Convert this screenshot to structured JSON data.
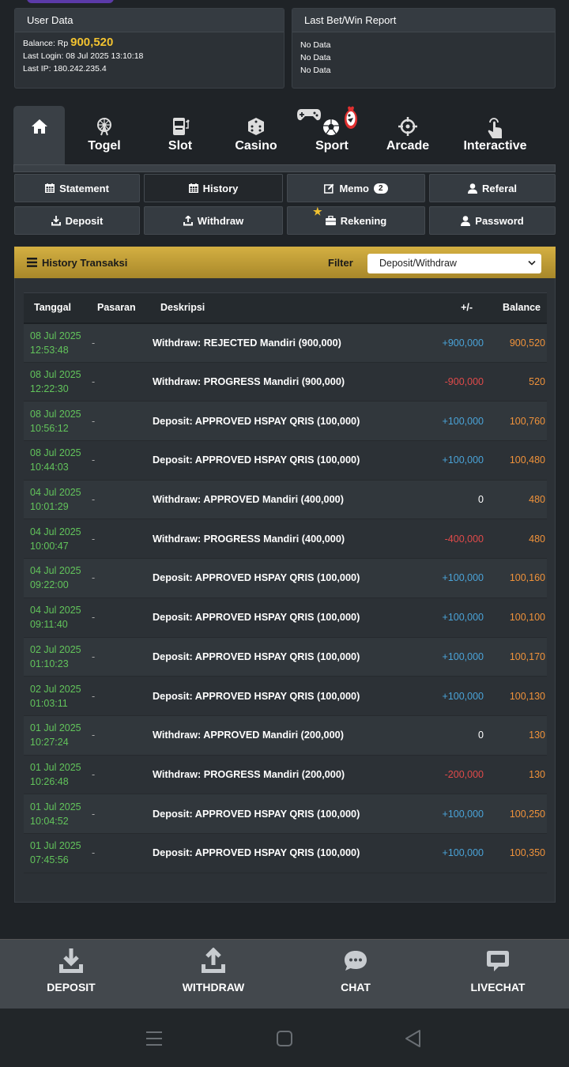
{
  "user_panel": {
    "title": "User Data",
    "balance_label": "Balance: Rp",
    "balance_value": "900,520",
    "last_login": "Last Login: 08 Jul 2025 13:10:18",
    "last_ip": "Last IP: 180.242.235.4"
  },
  "report_panel": {
    "title": "Last Bet/Win Report",
    "lines": [
      "No Data",
      "No Data",
      "No Data"
    ]
  },
  "categories": [
    "Togel",
    "Slot",
    "Casino",
    "Sport",
    "Arcade",
    "Interactive"
  ],
  "menu": {
    "statement": "Statement",
    "history": "History",
    "memo": "Memo",
    "memo_count": "2",
    "referal": "Referal",
    "deposit": "Deposit",
    "withdraw": "Withdraw",
    "rekening": "Rekening",
    "password": "Password"
  },
  "history": {
    "title": "History Transaksi",
    "filter_label": "Filter",
    "filter_value": "Deposit/Withdraw",
    "columns": [
      "Tanggal",
      "Pasaran",
      "Deskripsi",
      "+/-",
      "Balance"
    ],
    "rows": [
      {
        "date": "08 Jul 2025",
        "time": "12:53:48",
        "pasaran": "-",
        "desc": "Withdraw: REJECTED Mandiri (900,000)",
        "amount": "+900,000",
        "sign": "pos",
        "balance": "900,520"
      },
      {
        "date": "08 Jul 2025",
        "time": "12:22:30",
        "pasaran": "-",
        "desc": "Withdraw: PROGRESS Mandiri (900,000)",
        "amount": "-900,000",
        "sign": "neg",
        "balance": "520"
      },
      {
        "date": "08 Jul 2025",
        "time": "10:56:12",
        "pasaran": "-",
        "desc": "Deposit: APPROVED HSPAY QRIS (100,000)",
        "amount": "+100,000",
        "sign": "pos",
        "balance": "100,760"
      },
      {
        "date": "08 Jul 2025",
        "time": "10:44:03",
        "pasaran": "-",
        "desc": "Deposit: APPROVED HSPAY QRIS (100,000)",
        "amount": "+100,000",
        "sign": "pos",
        "balance": "100,480"
      },
      {
        "date": "04 Jul 2025",
        "time": "10:01:29",
        "pasaran": "-",
        "desc": "Withdraw: APPROVED Mandiri (400,000)",
        "amount": "0",
        "sign": "zero",
        "balance": "480"
      },
      {
        "date": "04 Jul 2025",
        "time": "10:00:47",
        "pasaran": "-",
        "desc": "Withdraw: PROGRESS Mandiri (400,000)",
        "amount": "-400,000",
        "sign": "neg",
        "balance": "480"
      },
      {
        "date": "04 Jul 2025",
        "time": "09:22:00",
        "pasaran": "-",
        "desc": "Deposit: APPROVED HSPAY QRIS (100,000)",
        "amount": "+100,000",
        "sign": "pos",
        "balance": "100,160"
      },
      {
        "date": "04 Jul 2025",
        "time": "09:11:40",
        "pasaran": "-",
        "desc": "Deposit: APPROVED HSPAY QRIS (100,000)",
        "amount": "+100,000",
        "sign": "pos",
        "balance": "100,100"
      },
      {
        "date": "02 Jul 2025",
        "time": "01:10:23",
        "pasaran": "-",
        "desc": "Deposit: APPROVED HSPAY QRIS (100,000)",
        "amount": "+100,000",
        "sign": "pos",
        "balance": "100,170"
      },
      {
        "date": "02 Jul 2025",
        "time": "01:03:11",
        "pasaran": "-",
        "desc": "Deposit: APPROVED HSPAY QRIS (100,000)",
        "amount": "+100,000",
        "sign": "pos",
        "balance": "100,130"
      },
      {
        "date": "01 Jul 2025",
        "time": "10:27:24",
        "pasaran": "-",
        "desc": "Withdraw: APPROVED Mandiri (200,000)",
        "amount": "0",
        "sign": "zero",
        "balance": "130"
      },
      {
        "date": "01 Jul 2025",
        "time": "10:26:48",
        "pasaran": "-",
        "desc": "Withdraw: PROGRESS Mandiri (200,000)",
        "amount": "-200,000",
        "sign": "neg",
        "balance": "130"
      },
      {
        "date": "01 Jul 2025",
        "time": "10:04:52",
        "pasaran": "-",
        "desc": "Deposit: APPROVED HSPAY QRIS (100,000)",
        "amount": "+100,000",
        "sign": "pos",
        "balance": "100,250"
      },
      {
        "date": "01 Jul 2025",
        "time": "07:45:56",
        "pasaran": "-",
        "desc": "Deposit: APPROVED HSPAY QRIS (100,000)",
        "amount": "+100,000",
        "sign": "pos",
        "balance": "100,350"
      }
    ]
  },
  "bottom_nav": [
    "DEPOSIT",
    "WITHDRAW",
    "CHAT",
    "LIVECHAT"
  ],
  "colors": {
    "accent_gold": "#f2c230",
    "date_green": "#62c45b",
    "positive_blue": "#4aa3d8",
    "negative_red": "#e04a4a",
    "balance_orange": "#f0923a"
  }
}
